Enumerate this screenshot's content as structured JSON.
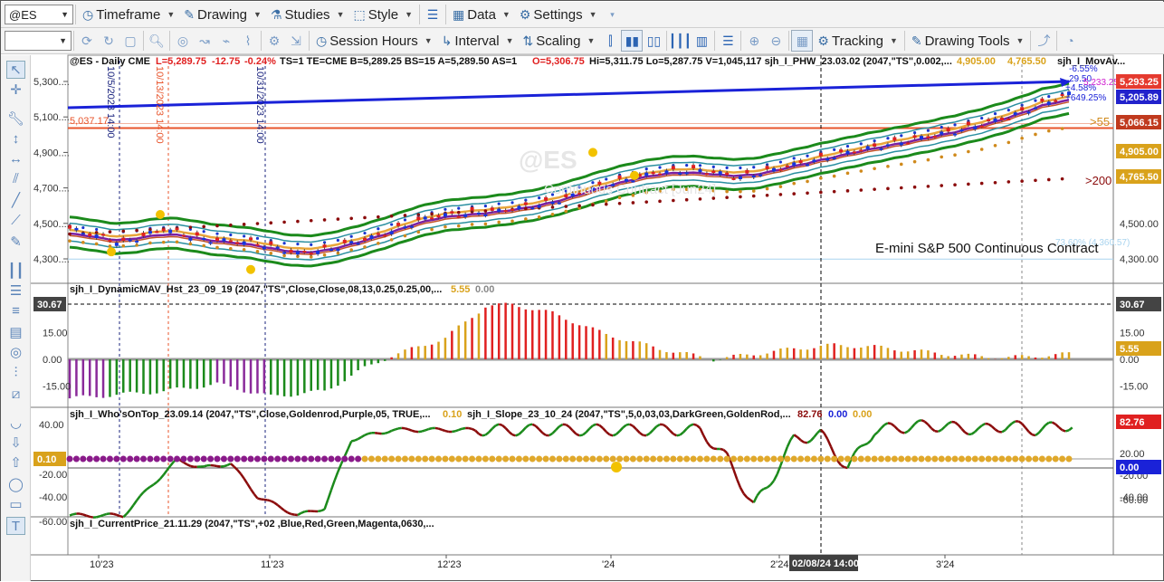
{
  "toolbar1": {
    "symbol": "@ES",
    "timeframe": "Timeframe",
    "drawing": "Drawing",
    "studies": "Studies",
    "style": "Style",
    "data": "Data",
    "settings": "Settings"
  },
  "toolbar2": {
    "session_hours": "Session Hours",
    "interval": "Interval",
    "scaling": "Scaling",
    "tracking": "Tracking",
    "drawing_tools": "Drawing Tools"
  },
  "price_panel": {
    "header_symbol": "@ES - Daily  CME",
    "header_L": "L=5,289.75",
    "header_chg": "-12.75",
    "header_pct": "-0.24%",
    "header_mid": "TS=1  TE=CME  B=5,289.25  BS=15  A=5,289.50  AS=1",
    "header_O": "O=5,306.75",
    "header_rest": "Hi=5,311.75  Lo=5,287.75  V=1,045,117  sjh_I_PHW_23.03.02 (2047,\"TS\",0.002,...",
    "header_v1": "4,905.00",
    "header_v2": "4,765.50",
    "header_tail": "sjh_I_MovAv...",
    "contract_label": "E-mini S&P 500 Continuous Contract",
    "watermark_symbol": "@ES",
    "watermark_text": "Continuous Contract [Jun24]",
    "line_label_left": "5,037.17",
    "fib_label": "73.60% (4,360.57)",
    "ma200_label": ">200",
    "ma55_label": ">55",
    "vlines": [
      "10/5/2023 14:00",
      "10/13/2023 14:00",
      "10/31/2023 14:00"
    ],
    "y_ticks": [
      "5,300....",
      "5,100....",
      "4,900....",
      "4,700....",
      "4,500....",
      "4,300...."
    ],
    "right_ticks": [
      "4,500.00",
      "4,300.00"
    ],
    "badges": [
      {
        "text": "5,293.25",
        "color": "#e53a2f"
      },
      {
        "text": "5,205.89",
        "color": "#2222cc"
      },
      {
        "text": "5,066.15",
        "color": "#c03a1e"
      },
      {
        "text": "4,905.00",
        "color": "#d9a21b"
      },
      {
        "text": "4,765.50",
        "color": "#d9a21b"
      }
    ],
    "top_right_labels": [
      "-6.55%",
      "29.50",
      "+4.58%",
      "5,233.25",
      "+649.25%"
    ]
  },
  "hist_panel": {
    "header": "sjh_I_DynamicMAV_Hst_23_09_19 (2047,\"TS\",Close,Close,08,13,0.25,0.25,00,...",
    "v1": "5.55",
    "v2": "0.00",
    "left_badge": "30.67",
    "right_badge_top": "30.67",
    "right_badge_val": "5.55",
    "y_ticks": [
      "15.00",
      "0.00",
      "-15.00"
    ],
    "right_ticks": [
      "15.00",
      "0.00",
      "-15.00"
    ]
  },
  "osc_panel": {
    "header1": "sjh_I_Who'sOnTop_23.09.14 (2047,\"TS\",Close,Goldenrod,Purple,05,  TRUE,...",
    "h1_val": "0.10",
    "header2": "sjh_I_Slope_23_10_24 (2047,\"TS\",5,0,03,03,DarkGreen,GoldenRod,...",
    "h2_v1": "82.76",
    "h2_v2": "0.00",
    "h2_v3": "0.00",
    "left_badge": "0.10",
    "right_badge_top": "82.76",
    "right_badge_zero": "0.00",
    "y_ticks": [
      "40.00",
      "20.00",
      "-20.00",
      "-40.00",
      "-60.00"
    ],
    "right_ticks": [
      "40.00",
      "20.00",
      "-20.00",
      "-40.00",
      "-60.00"
    ]
  },
  "bottom_panel": {
    "header": "sjh_I_CurrentPrice_21.11.29 (2047,\"TS\",+02 ,Blue,Red,Green,Magenta,0630,..."
  },
  "x_axis": {
    "labels": [
      "10'23",
      "11'23",
      "12'23",
      "'24",
      "2'24",
      "3'24"
    ],
    "cursor_label": "02/08/24 14:00"
  }
}
